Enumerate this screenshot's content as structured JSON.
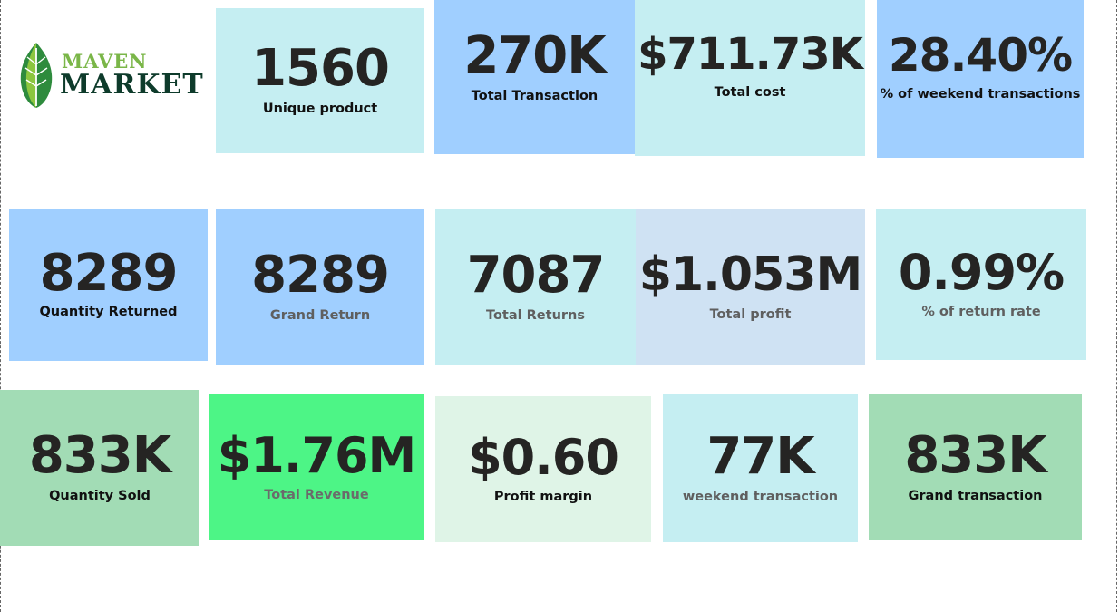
{
  "logo": {
    "line1": "MAVEN",
    "line2": "MARKET",
    "colors": {
      "leaf_light": "#8cc63f",
      "leaf_dark": "#2e8b3d",
      "text_dark": "#0e3b2b",
      "text_light": "#7ab648"
    }
  },
  "cards": {
    "unique_product": {
      "value": "1560",
      "label": "Unique product",
      "bg": "#c5eef2"
    },
    "total_transaction": {
      "value": "270K",
      "label": "Total Transaction",
      "bg": "#a0cfff"
    },
    "total_cost": {
      "value": "$711.73K",
      "label": "Total cost",
      "bg": "#c5eef2"
    },
    "weekend_pct": {
      "value": "28.40%",
      "label": "% of weekend transactions",
      "bg": "#a0cfff"
    },
    "quantity_returned": {
      "value": "8289",
      "label": "Quantity Returned",
      "bg": "#a0cfff"
    },
    "grand_return": {
      "value": "8289",
      "label": "Grand Return",
      "bg": "#a0cfff"
    },
    "total_returns": {
      "value": "7087",
      "label": "Total Returns",
      "bg": "#c5eef2"
    },
    "total_profit": {
      "value": "$1.053M",
      "label": "Total profit",
      "bg": "#cfe2f3"
    },
    "return_rate": {
      "value": "0.99%",
      "label": "% of return rate",
      "bg": "#c5eef2"
    },
    "quantity_sold": {
      "value": "833K",
      "label": "Quantity Sold",
      "bg": "#a2dcb5"
    },
    "total_revenue": {
      "value": "$1.76M",
      "label": "Total Revenue",
      "bg": "#4df586"
    },
    "profit_margin": {
      "value": "$0.60",
      "label": "Profit margin",
      "bg": "#dff4e7"
    },
    "weekend_transaction": {
      "value": "77K",
      "label": "weekend transaction",
      "bg": "#c5eef2"
    },
    "grand_transaction": {
      "value": "833K",
      "label": "Grand transaction",
      "bg": "#a2dcb5"
    }
  }
}
